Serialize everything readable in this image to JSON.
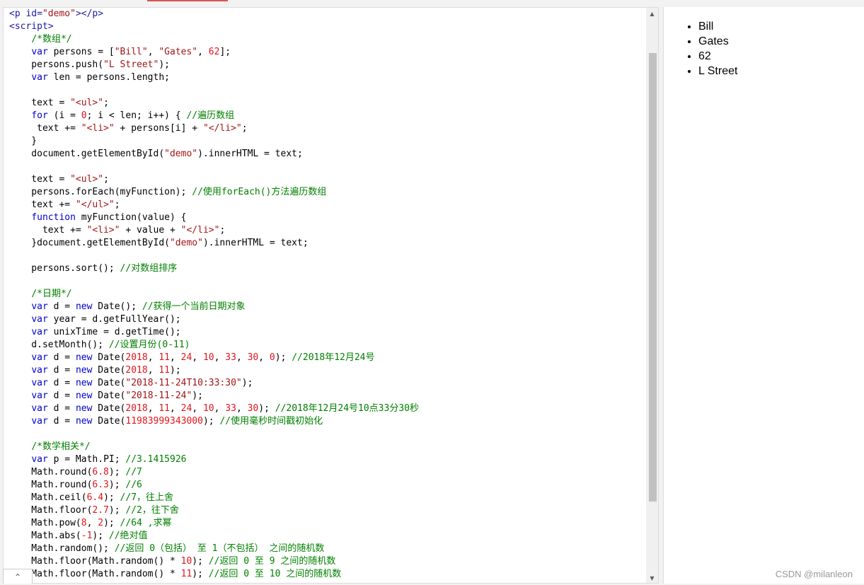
{
  "editor": {
    "lines": [
      [
        {
          "c": "tag",
          "t": "<p "
        },
        {
          "c": "attr",
          "t": "id"
        },
        {
          "c": "tag",
          "t": "="
        },
        {
          "c": "str",
          "t": "\"demo\""
        },
        {
          "c": "tag",
          "t": "></p>"
        }
      ],
      [
        {
          "c": "tag",
          "t": "<script>"
        }
      ],
      [
        {
          "c": "t",
          "t": "    "
        },
        {
          "c": "cm",
          "t": "/*数组*/"
        }
      ],
      [
        {
          "c": "t",
          "t": "    "
        },
        {
          "c": "kw",
          "t": "var"
        },
        {
          "c": "t",
          "t": " persons = ["
        },
        {
          "c": "str",
          "t": "\"Bill\""
        },
        {
          "c": "t",
          "t": ", "
        },
        {
          "c": "str",
          "t": "\"Gates\""
        },
        {
          "c": "t",
          "t": ", "
        },
        {
          "c": "num",
          "t": "62"
        },
        {
          "c": "t",
          "t": "];"
        }
      ],
      [
        {
          "c": "t",
          "t": "    persons.push("
        },
        {
          "c": "str",
          "t": "\"L Street\""
        },
        {
          "c": "t",
          "t": ");"
        }
      ],
      [
        {
          "c": "t",
          "t": "    "
        },
        {
          "c": "kw",
          "t": "var"
        },
        {
          "c": "t",
          "t": " len = persons.length;"
        }
      ],
      [],
      [
        {
          "c": "t",
          "t": "    text = "
        },
        {
          "c": "str",
          "t": "\"<ul>\""
        },
        {
          "c": "t",
          "t": ";"
        }
      ],
      [
        {
          "c": "t",
          "t": "    "
        },
        {
          "c": "kw",
          "t": "for"
        },
        {
          "c": "t",
          "t": " (i = "
        },
        {
          "c": "num",
          "t": "0"
        },
        {
          "c": "t",
          "t": "; i < len; i++) { "
        },
        {
          "c": "cm",
          "t": "//遍历数组"
        }
      ],
      [
        {
          "c": "t",
          "t": "     text += "
        },
        {
          "c": "str",
          "t": "\"<li>\""
        },
        {
          "c": "t",
          "t": " + persons[i] + "
        },
        {
          "c": "str",
          "t": "\"</li>\""
        },
        {
          "c": "t",
          "t": ";"
        }
      ],
      [
        {
          "c": "t",
          "t": "    }"
        }
      ],
      [
        {
          "c": "t",
          "t": "    document.getElementById("
        },
        {
          "c": "str",
          "t": "\"demo\""
        },
        {
          "c": "t",
          "t": ").innerHTML = text;"
        }
      ],
      [],
      [
        {
          "c": "t",
          "t": "    text = "
        },
        {
          "c": "str",
          "t": "\"<ul>\""
        },
        {
          "c": "t",
          "t": ";"
        }
      ],
      [
        {
          "c": "t",
          "t": "    persons.forEach(myFunction); "
        },
        {
          "c": "cm",
          "t": "//使用forEach()方法遍历数组"
        }
      ],
      [
        {
          "c": "t",
          "t": "    text += "
        },
        {
          "c": "str",
          "t": "\"</ul>\""
        },
        {
          "c": "t",
          "t": ";"
        }
      ],
      [
        {
          "c": "t",
          "t": "    "
        },
        {
          "c": "kw",
          "t": "function"
        },
        {
          "c": "t",
          "t": " myFunction(value) {"
        }
      ],
      [
        {
          "c": "t",
          "t": "      text += "
        },
        {
          "c": "str",
          "t": "\"<li>\""
        },
        {
          "c": "t",
          "t": " + value + "
        },
        {
          "c": "str",
          "t": "\"</li>\""
        },
        {
          "c": "t",
          "t": ";"
        }
      ],
      [
        {
          "c": "t",
          "t": "    }document.getElementById("
        },
        {
          "c": "str",
          "t": "\"demo\""
        },
        {
          "c": "t",
          "t": ").innerHTML = text;"
        }
      ],
      [],
      [
        {
          "c": "t",
          "t": "    persons.sort(); "
        },
        {
          "c": "cm",
          "t": "//对数组排序"
        }
      ],
      [],
      [
        {
          "c": "t",
          "t": "    "
        },
        {
          "c": "cm",
          "t": "/*日期*/"
        }
      ],
      [
        {
          "c": "t",
          "t": "    "
        },
        {
          "c": "kw",
          "t": "var"
        },
        {
          "c": "t",
          "t": " d = "
        },
        {
          "c": "kw",
          "t": "new"
        },
        {
          "c": "t",
          "t": " Date(); "
        },
        {
          "c": "cm",
          "t": "//获得一个当前日期对象"
        }
      ],
      [
        {
          "c": "t",
          "t": "    "
        },
        {
          "c": "kw",
          "t": "var"
        },
        {
          "c": "t",
          "t": " year = d.getFullYear();"
        }
      ],
      [
        {
          "c": "t",
          "t": "    "
        },
        {
          "c": "kw",
          "t": "var"
        },
        {
          "c": "t",
          "t": " unixTime = d.getTime();"
        }
      ],
      [
        {
          "c": "t",
          "t": "    d.setMonth(); "
        },
        {
          "c": "cm",
          "t": "//设置月份(0-11)"
        }
      ],
      [
        {
          "c": "t",
          "t": "    "
        },
        {
          "c": "kw",
          "t": "var"
        },
        {
          "c": "t",
          "t": " d = "
        },
        {
          "c": "kw",
          "t": "new"
        },
        {
          "c": "t",
          "t": " Date("
        },
        {
          "c": "num",
          "t": "2018"
        },
        {
          "c": "t",
          "t": ", "
        },
        {
          "c": "num",
          "t": "11"
        },
        {
          "c": "t",
          "t": ", "
        },
        {
          "c": "num",
          "t": "24"
        },
        {
          "c": "t",
          "t": ", "
        },
        {
          "c": "num",
          "t": "10"
        },
        {
          "c": "t",
          "t": ", "
        },
        {
          "c": "num",
          "t": "33"
        },
        {
          "c": "t",
          "t": ", "
        },
        {
          "c": "num",
          "t": "30"
        },
        {
          "c": "t",
          "t": ", "
        },
        {
          "c": "num",
          "t": "0"
        },
        {
          "c": "t",
          "t": "); "
        },
        {
          "c": "cm",
          "t": "//2018年12月24号"
        }
      ],
      [
        {
          "c": "t",
          "t": "    "
        },
        {
          "c": "kw",
          "t": "var"
        },
        {
          "c": "t",
          "t": " d = "
        },
        {
          "c": "kw",
          "t": "new"
        },
        {
          "c": "t",
          "t": " Date("
        },
        {
          "c": "num",
          "t": "2018"
        },
        {
          "c": "t",
          "t": ", "
        },
        {
          "c": "num",
          "t": "11"
        },
        {
          "c": "t",
          "t": ");"
        }
      ],
      [
        {
          "c": "t",
          "t": "    "
        },
        {
          "c": "kw",
          "t": "var"
        },
        {
          "c": "t",
          "t": " d = "
        },
        {
          "c": "kw",
          "t": "new"
        },
        {
          "c": "t",
          "t": " Date("
        },
        {
          "c": "str",
          "t": "\"2018-11-24T10:33:30\""
        },
        {
          "c": "t",
          "t": ");"
        }
      ],
      [
        {
          "c": "t",
          "t": "    "
        },
        {
          "c": "kw",
          "t": "var"
        },
        {
          "c": "t",
          "t": " d = "
        },
        {
          "c": "kw",
          "t": "new"
        },
        {
          "c": "t",
          "t": " Date("
        },
        {
          "c": "str",
          "t": "\"2018-11-24\""
        },
        {
          "c": "t",
          "t": ");"
        }
      ],
      [
        {
          "c": "t",
          "t": "    "
        },
        {
          "c": "kw",
          "t": "var"
        },
        {
          "c": "t",
          "t": " d = "
        },
        {
          "c": "kw",
          "t": "new"
        },
        {
          "c": "t",
          "t": " Date("
        },
        {
          "c": "num",
          "t": "2018"
        },
        {
          "c": "t",
          "t": ", "
        },
        {
          "c": "num",
          "t": "11"
        },
        {
          "c": "t",
          "t": ", "
        },
        {
          "c": "num",
          "t": "24"
        },
        {
          "c": "t",
          "t": ", "
        },
        {
          "c": "num",
          "t": "10"
        },
        {
          "c": "t",
          "t": ", "
        },
        {
          "c": "num",
          "t": "33"
        },
        {
          "c": "t",
          "t": ", "
        },
        {
          "c": "num",
          "t": "30"
        },
        {
          "c": "t",
          "t": "); "
        },
        {
          "c": "cm",
          "t": "//2018年12月24号10点33分30秒"
        }
      ],
      [
        {
          "c": "t",
          "t": "    "
        },
        {
          "c": "kw",
          "t": "var"
        },
        {
          "c": "t",
          "t": " d = "
        },
        {
          "c": "kw",
          "t": "new"
        },
        {
          "c": "t",
          "t": " Date("
        },
        {
          "c": "num",
          "t": "11983999343000"
        },
        {
          "c": "t",
          "t": "); "
        },
        {
          "c": "cm",
          "t": "//使用毫秒时间戳初始化"
        }
      ],
      [],
      [
        {
          "c": "t",
          "t": "    "
        },
        {
          "c": "cm",
          "t": "/*数学相关*/"
        }
      ],
      [
        {
          "c": "t",
          "t": "    "
        },
        {
          "c": "kw",
          "t": "var"
        },
        {
          "c": "t",
          "t": " p = Math.PI; "
        },
        {
          "c": "cm",
          "t": "//3.1415926"
        }
      ],
      [
        {
          "c": "t",
          "t": "    Math.round("
        },
        {
          "c": "num",
          "t": "6.8"
        },
        {
          "c": "t",
          "t": "); "
        },
        {
          "c": "cm",
          "t": "//7"
        }
      ],
      [
        {
          "c": "t",
          "t": "    Math.round("
        },
        {
          "c": "num",
          "t": "6.3"
        },
        {
          "c": "t",
          "t": "); "
        },
        {
          "c": "cm",
          "t": "//6"
        }
      ],
      [
        {
          "c": "t",
          "t": "    Math.ceil("
        },
        {
          "c": "num",
          "t": "6.4"
        },
        {
          "c": "t",
          "t": "); "
        },
        {
          "c": "cm",
          "t": "//7，往上舍"
        }
      ],
      [
        {
          "c": "t",
          "t": "    Math.floor("
        },
        {
          "c": "num",
          "t": "2.7"
        },
        {
          "c": "t",
          "t": "); "
        },
        {
          "c": "cm",
          "t": "//2，往下舍"
        }
      ],
      [
        {
          "c": "t",
          "t": "    Math.pow("
        },
        {
          "c": "num",
          "t": "8"
        },
        {
          "c": "t",
          "t": ", "
        },
        {
          "c": "num",
          "t": "2"
        },
        {
          "c": "t",
          "t": "); "
        },
        {
          "c": "cm",
          "t": "//64 ,求幂"
        }
      ],
      [
        {
          "c": "t",
          "t": "    Math.abs("
        },
        {
          "c": "num",
          "t": "-1"
        },
        {
          "c": "t",
          "t": "); "
        },
        {
          "c": "cm",
          "t": "//绝对值"
        }
      ],
      [
        {
          "c": "t",
          "t": "    Math.random(); "
        },
        {
          "c": "cm",
          "t": "//返回 0（包括） 至 1（不包括） 之间的随机数"
        }
      ],
      [
        {
          "c": "t",
          "t": "    Math.floor(Math.random() * "
        },
        {
          "c": "num",
          "t": "10"
        },
        {
          "c": "t",
          "t": "); "
        },
        {
          "c": "cm",
          "t": "//返回 0 至 9 之间的随机数"
        }
      ],
      [
        {
          "c": "t",
          "t": "    Math.floor(Math.random() * "
        },
        {
          "c": "num",
          "t": "11"
        },
        {
          "c": "t",
          "t": "); "
        },
        {
          "c": "cm",
          "t": "//返回 0 至 10 之间的随机数"
        }
      ]
    ]
  },
  "scrollbar": {
    "up_arrow": "▲",
    "down_arrow": "▼"
  },
  "collapse_button": {
    "icon": "chevron-up-icon",
    "glyph": "⌃"
  },
  "result": {
    "items": [
      "Bill",
      "Gates",
      "62",
      "L Street"
    ]
  },
  "watermark": "CSDN @milanleon"
}
